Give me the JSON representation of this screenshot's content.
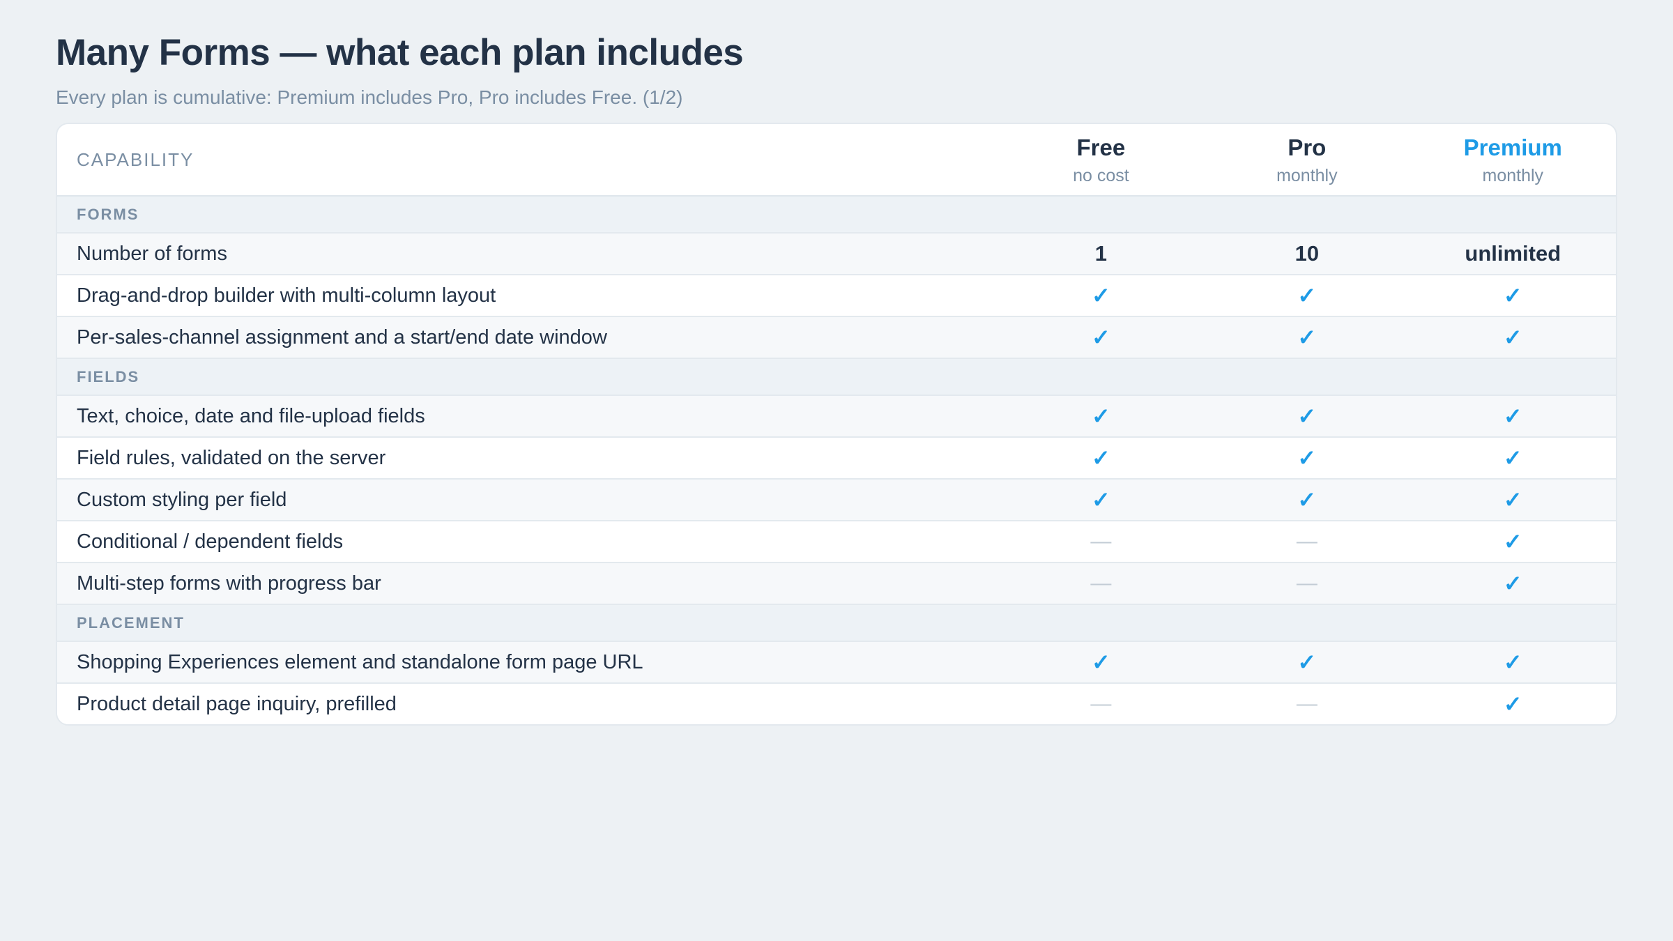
{
  "title": "Many Forms — what each plan includes",
  "subtitle": "Every plan is cumulative: Premium includes Pro, Pro includes Free. (1/2)",
  "table": {
    "capability_header": "CAPABILITY",
    "plans": [
      {
        "name": "Free",
        "sub": "no cost",
        "accent": false
      },
      {
        "name": "Pro",
        "sub": "monthly",
        "accent": false
      },
      {
        "name": "Premium",
        "sub": "monthly",
        "accent": true
      }
    ],
    "colors": {
      "accent": "#1e9be6",
      "text": "#233246",
      "muted": "#7a8ea3"
    },
    "sections": [
      {
        "label": "FORMS",
        "rows": [
          {
            "label": "Number of forms",
            "cells": [
              {
                "type": "text",
                "text": "1"
              },
              {
                "type": "text",
                "text": "10"
              },
              {
                "type": "text",
                "text": "unlimited"
              }
            ]
          },
          {
            "label": "Drag-and-drop builder with multi-column layout",
            "cells": [
              {
                "type": "check",
                "text": "✓"
              },
              {
                "type": "check",
                "text": "✓"
              },
              {
                "type": "check",
                "text": "✓"
              }
            ]
          },
          {
            "label": "Per-sales-channel assignment and a start/end date window",
            "cells": [
              {
                "type": "check",
                "text": "✓"
              },
              {
                "type": "check",
                "text": "✓"
              },
              {
                "type": "check",
                "text": "✓"
              }
            ]
          }
        ]
      },
      {
        "label": "FIELDS",
        "rows": [
          {
            "label": "Text, choice, date and file-upload fields",
            "cells": [
              {
                "type": "check",
                "text": "✓"
              },
              {
                "type": "check",
                "text": "✓"
              },
              {
                "type": "check",
                "text": "✓"
              }
            ]
          },
          {
            "label": "Field rules, validated on the server",
            "cells": [
              {
                "type": "check",
                "text": "✓"
              },
              {
                "type": "check",
                "text": "✓"
              },
              {
                "type": "check",
                "text": "✓"
              }
            ]
          },
          {
            "label": "Custom styling per field",
            "cells": [
              {
                "type": "check",
                "text": "✓"
              },
              {
                "type": "check",
                "text": "✓"
              },
              {
                "type": "check",
                "text": "✓"
              }
            ]
          },
          {
            "label": "Conditional / dependent fields",
            "cells": [
              {
                "type": "dash",
                "text": "—"
              },
              {
                "type": "dash",
                "text": "—"
              },
              {
                "type": "check",
                "text": "✓"
              }
            ]
          },
          {
            "label": "Multi-step forms with progress bar",
            "cells": [
              {
                "type": "dash",
                "text": "—"
              },
              {
                "type": "dash",
                "text": "—"
              },
              {
                "type": "check",
                "text": "✓"
              }
            ]
          }
        ]
      },
      {
        "label": "PLACEMENT",
        "rows": [
          {
            "label": "Shopping Experiences element and standalone form page URL",
            "cells": [
              {
                "type": "check",
                "text": "✓"
              },
              {
                "type": "check",
                "text": "✓"
              },
              {
                "type": "check",
                "text": "✓"
              }
            ]
          },
          {
            "label": "Product detail page inquiry, prefilled",
            "cells": [
              {
                "type": "dash",
                "text": "—"
              },
              {
                "type": "dash",
                "text": "—"
              },
              {
                "type": "check",
                "text": "✓"
              }
            ]
          }
        ]
      }
    ]
  }
}
